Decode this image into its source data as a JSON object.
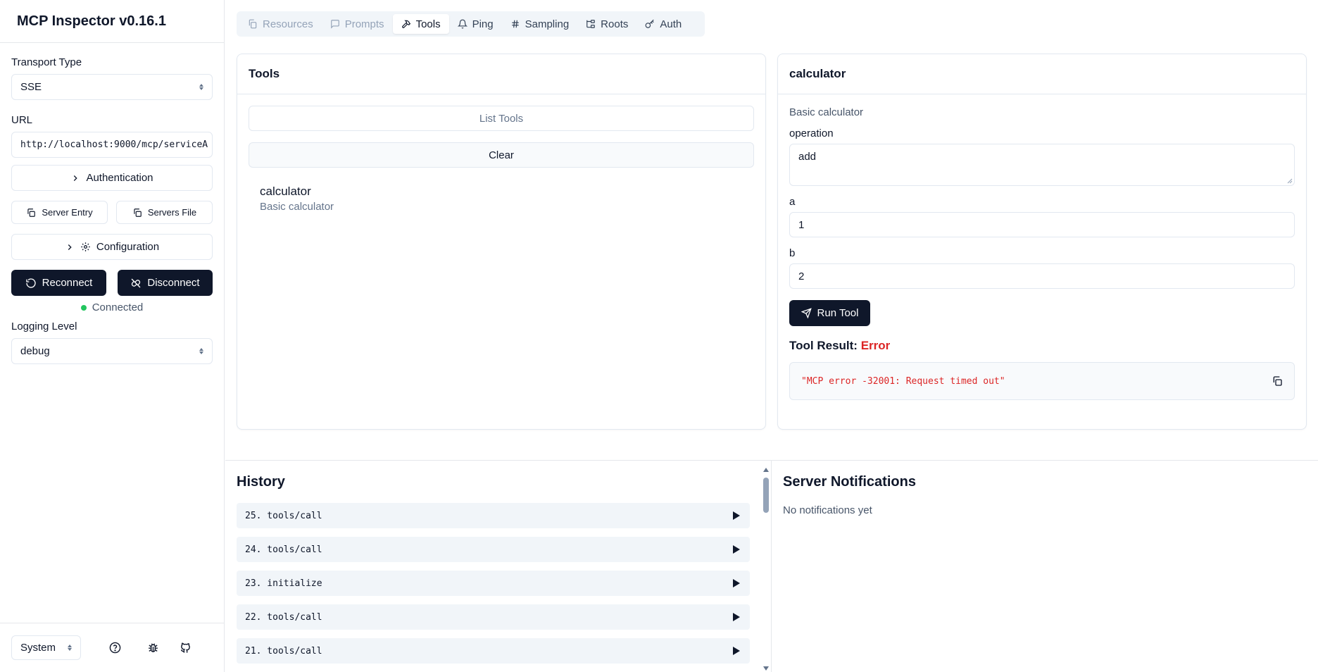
{
  "app": {
    "title": "MCP Inspector v0.16.1"
  },
  "sidebar": {
    "transport_label": "Transport Type",
    "transport_value": "SSE",
    "url_label": "URL",
    "url_value": "http://localhost:9000/mcp/serviceA",
    "authentication_label": "Authentication",
    "server_entry_label": "Server Entry",
    "servers_file_label": "Servers File",
    "configuration_label": "Configuration",
    "reconnect_label": "Reconnect",
    "disconnect_label": "Disconnect",
    "status_text": "Connected",
    "status_color": "#22c55e",
    "logging_label": "Logging Level",
    "logging_value": "debug",
    "theme_value": "System"
  },
  "tabs": [
    {
      "label": "Resources",
      "icon": "files-icon",
      "state": "disabled"
    },
    {
      "label": "Prompts",
      "icon": "message-icon",
      "state": "disabled"
    },
    {
      "label": "Tools",
      "icon": "hammer-icon",
      "state": "active"
    },
    {
      "label": "Ping",
      "icon": "bell-icon",
      "state": "normal"
    },
    {
      "label": "Sampling",
      "icon": "hash-icon",
      "state": "normal"
    },
    {
      "label": "Roots",
      "icon": "folder-tree-icon",
      "state": "normal"
    },
    {
      "label": "Auth",
      "icon": "key-icon",
      "state": "normal"
    }
  ],
  "tools_panel": {
    "title": "Tools",
    "list_button": "List Tools",
    "clear_button": "Clear",
    "items": [
      {
        "name": "calculator",
        "description": "Basic calculator"
      }
    ]
  },
  "tool_detail": {
    "title": "calculator",
    "description": "Basic calculator",
    "fields": [
      {
        "label": "operation",
        "value": "add"
      },
      {
        "label": "a",
        "value": "1"
      },
      {
        "label": "b",
        "value": "2"
      }
    ],
    "run_button": "Run Tool",
    "result_label": "Tool Result:",
    "result_status": "Error",
    "result_status_color": "#dc2626",
    "result_text": "\"MCP error -32001: Request timed out\""
  },
  "history": {
    "title": "History",
    "items": [
      "25. tools/call",
      "24. tools/call",
      "23. initialize",
      "22. tools/call",
      "21. tools/call"
    ]
  },
  "notifications": {
    "title": "Server Notifications",
    "empty_text": "No notifications yet"
  }
}
